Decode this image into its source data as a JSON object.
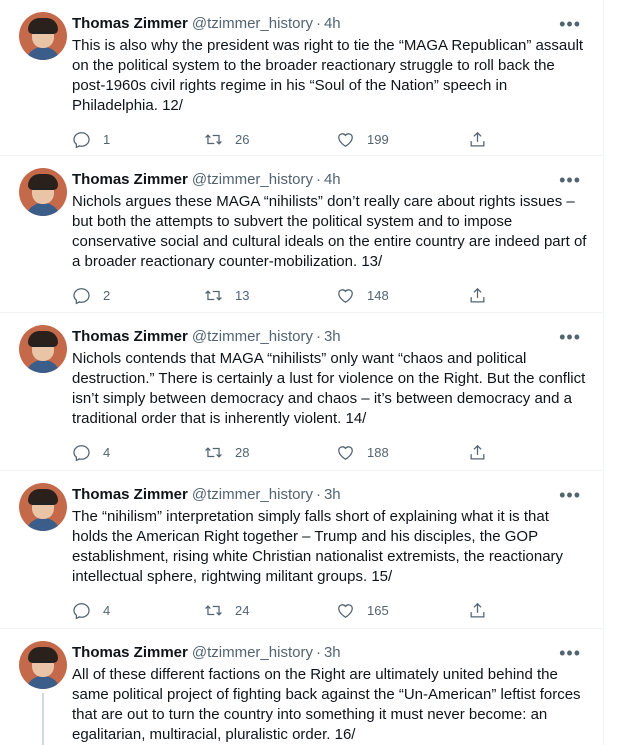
{
  "author": {
    "name": "Thomas Zimmer",
    "handle": "@tzimmer_history"
  },
  "tweets": [
    {
      "time": "4h",
      "text": "This is also why the president was right to tie the “MAGA Republican” assault on the political system to the broader reactionary struggle to roll back the post-1960s civil rights regime in his “Soul of the Nation” speech in Philadelphia. 12/",
      "replies": "1",
      "retweets": "26",
      "likes": "199"
    },
    {
      "time": "4h",
      "text": "Nichols argues these MAGA “nihilists” don’t really care about rights issues – but both the attempts to subvert the political system and to impose conservative social and cultural ideals on the entire country are indeed part of a broader reactionary counter-mobilization. 13/",
      "replies": "2",
      "retweets": "13",
      "likes": "148"
    },
    {
      "time": "3h",
      "text": "Nichols contends that MAGA “nihilists” only want “chaos and political destruction.” There is certainly a lust for violence on the Right. But the conflict isn’t simply between democracy and chaos – it’s between democracy and a traditional order that is inherently violent. 14/",
      "replies": "4",
      "retweets": "28",
      "likes": "188"
    },
    {
      "time": "3h",
      "text": "The “nihilism” interpretation simply falls short of explaining what it is that holds the American Right together – Trump and his disciples, the GOP establishment, rising white Christian nationalist extremists, the reactionary intellectual sphere, rightwing militant groups. 15/",
      "replies": "4",
      "retweets": "24",
      "likes": "165"
    },
    {
      "time": "3h",
      "text": "All of these different factions on the Right are ultimately united behind the same political project of fighting back against the “Un-American” leftist forces that are out to turn the country into something it must never become: an egalitarian, multiracial, pluralistic order. 16/"
    }
  ],
  "ui": {
    "dot": "·",
    "more": "•••"
  },
  "colors": {
    "text": "#0f1419",
    "secondary": "#536471",
    "thread_line": "#cfd9de",
    "divider": "#eff3f4"
  },
  "icons": {
    "reply": "reply-icon",
    "retweet": "retweet-icon",
    "like": "like-icon",
    "share": "share-icon"
  }
}
